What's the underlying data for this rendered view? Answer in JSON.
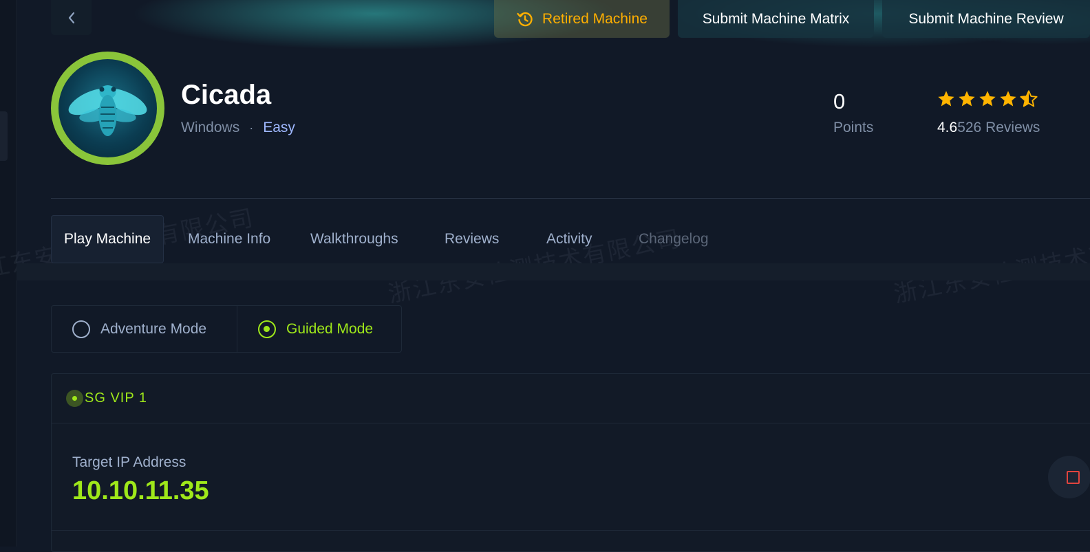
{
  "header": {
    "retired_label": "Retired Machine",
    "submit_matrix_label": "Submit Machine Matrix",
    "submit_review_label": "Submit Machine Review"
  },
  "machine": {
    "name": "Cicada",
    "os": "Windows",
    "separator": "·",
    "difficulty": "Easy",
    "points_value": "0",
    "points_label": "Points",
    "rating_score": "4.6",
    "reviews_text": "526 Reviews",
    "rating_stars": 4.5
  },
  "tabs": [
    {
      "label": "Play Machine"
    },
    {
      "label": "Machine Info"
    },
    {
      "label": "Walkthroughs"
    },
    {
      "label": "Reviews"
    },
    {
      "label": "Activity"
    },
    {
      "label": "Changelog"
    }
  ],
  "modes": {
    "adventure_label": "Adventure Mode",
    "guided_label": "Guided Mode",
    "selected": "Guided Mode"
  },
  "server": {
    "name": "SG VIP 1",
    "ip_label": "Target IP Address",
    "ip_value": "10.10.11.35"
  },
  "watermark_text": "浙江东安检测技术有限公司",
  "colors": {
    "background": "#111927",
    "accent_green": "#9fe81a",
    "retired_orange": "#ffaf00",
    "star_gold": "#ffb400",
    "muted_text": "#7f8ea5",
    "difficulty_blue": "#9fb8ff",
    "stop_red": "#e0443e"
  },
  "icons": {
    "back": "chevron-left-icon",
    "retired": "history-icon",
    "stop": "stop-icon"
  }
}
